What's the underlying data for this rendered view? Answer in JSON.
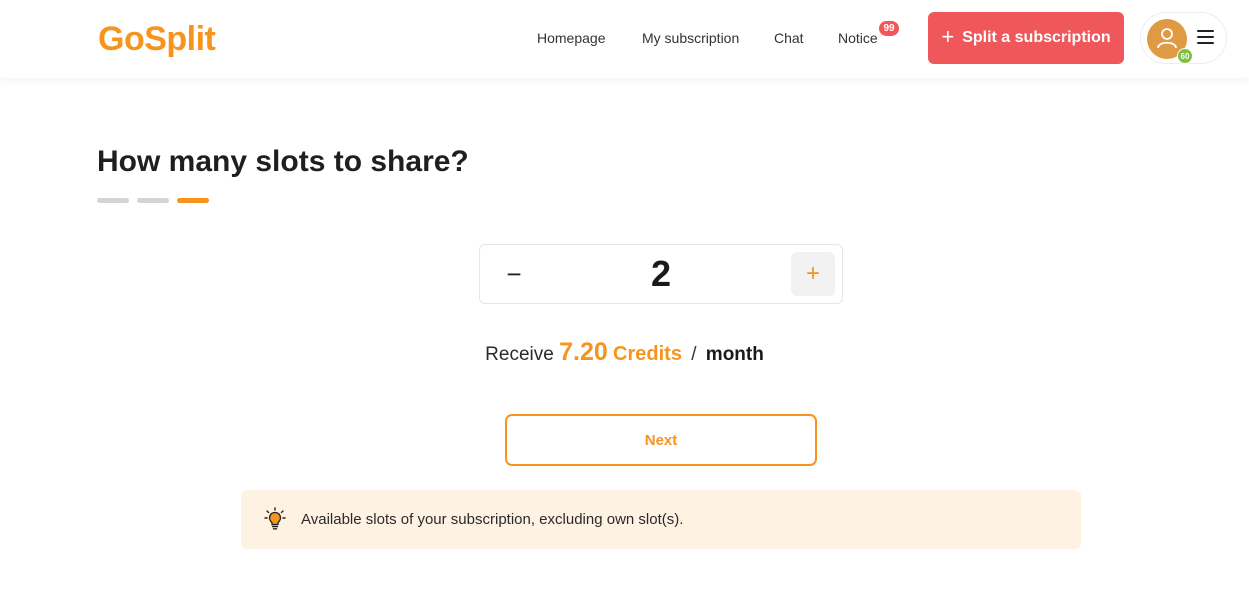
{
  "header": {
    "logo": "GoSplit",
    "nav": [
      "Homepage",
      "My subscription",
      "Chat",
      "Notice"
    ],
    "notice_badge": "99",
    "split_button": "Split a subscription",
    "user_level": "60"
  },
  "main": {
    "title": "How many slots to share?",
    "steps": {
      "total": 3,
      "current": 3
    },
    "stepper": {
      "minus": "−",
      "value": "2",
      "plus": "+"
    },
    "receive": {
      "prefix": "Receive",
      "amount": "7.20",
      "unit": "Credits",
      "separator": "/",
      "period": "month"
    },
    "next_button": "Next",
    "tip": "Available slots of your subscription, excluding own slot(s)."
  },
  "colors": {
    "accent": "#f7941d",
    "cta": "#f0575a",
    "tip_bg": "#fef2e3",
    "level_badge": "#7cc142"
  },
  "icons": [
    "plus-icon",
    "user-icon",
    "menu-icon",
    "lightbulb-icon"
  ]
}
